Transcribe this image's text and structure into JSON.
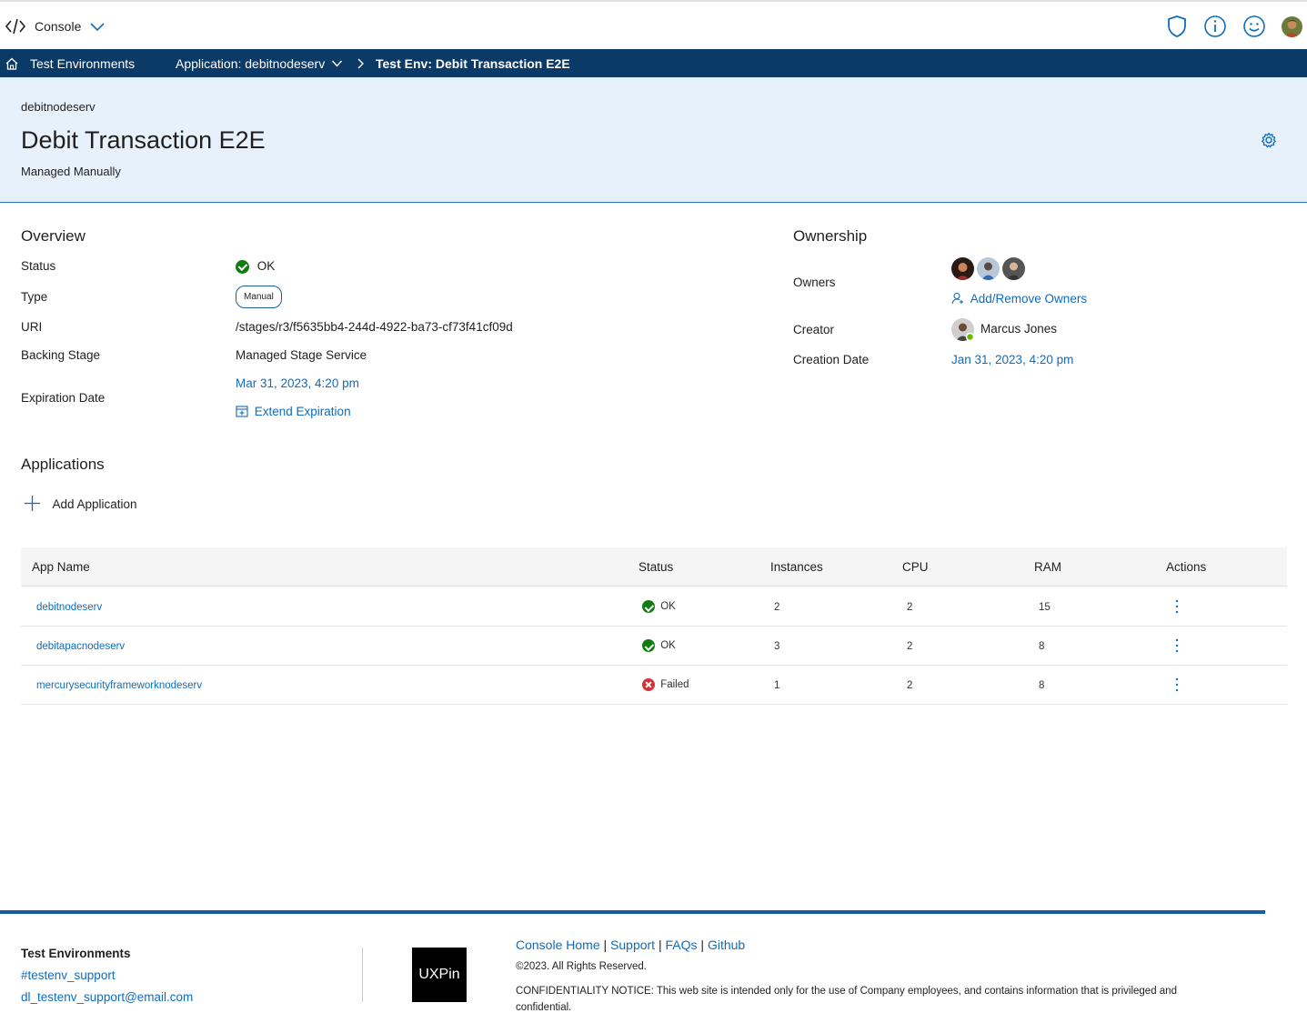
{
  "topbar": {
    "app_name": "Console",
    "icons": [
      "code-icon",
      "chevron-down-icon",
      "shield-icon",
      "info-icon",
      "smiley-icon",
      "user-avatar"
    ]
  },
  "breadcrumb": {
    "home": "Test Environments",
    "application": "Application: debitnodeserv",
    "current": "Test Env: Debit Transaction E2E"
  },
  "header": {
    "eyebrow": "debitnodeserv",
    "title": "Debit Transaction E2E",
    "subtitle": "Managed Manually"
  },
  "overview": {
    "heading": "Overview",
    "status_label": "Status",
    "status_value": "OK",
    "type_label": "Type",
    "type_value": "Manual",
    "uri_label": "URI",
    "uri_value": "/stages/r3/f5635bb4-244d-4922-ba73-cf73f41cf09d",
    "backing_label": "Backing Stage",
    "backing_value": "Managed Stage Service",
    "expiration_label": "Expiration Date",
    "expiration_value": "Mar 31, 2023, 4:20 pm",
    "extend_label": "Extend Expiration"
  },
  "ownership": {
    "heading": "Ownership",
    "owners_label": "Owners",
    "add_remove_label": "Add/Remove Owners",
    "creator_label": "Creator",
    "creator_value": "Marcus Jones",
    "creation_label": "Creation Date",
    "creation_value": "Jan 31, 2023, 4:20 pm"
  },
  "applications": {
    "heading": "Applications",
    "add_label": "Add Application",
    "columns": [
      "App Name",
      "Status",
      "Instances",
      "CPU",
      "RAM",
      "Actions"
    ],
    "rows": [
      {
        "name": "debitnodeserv",
        "status": "OK",
        "instances": "2",
        "cpu": "2",
        "ram": "15"
      },
      {
        "name": "debitapacnodeserv",
        "status": "OK",
        "instances": "3",
        "cpu": "2",
        "ram": "8"
      },
      {
        "name": "mercurysecurityframeworknodeserv",
        "status": "Failed",
        "instances": "1",
        "cpu": "2",
        "ram": "8"
      }
    ]
  },
  "footer": {
    "title": "Test Environments",
    "slack": "#testenv_support",
    "email": "dl_testenv_support@email.com",
    "logo": "UXPin",
    "links": [
      "Console Home",
      "Support",
      "FAQs",
      "Github"
    ],
    "copyright": "©2023. All Rights Reserved.",
    "notice": "CONFIDENTIALITY NOTICE: This web site is intended only for the use of Company employees, and contains information that is privileged and confidential."
  },
  "colors": {
    "nav_bar": "#0b3a66",
    "header_bg": "#e7f1fb",
    "link": "#0f6cbd",
    "ok": "#107c10",
    "failed": "#d13438"
  }
}
